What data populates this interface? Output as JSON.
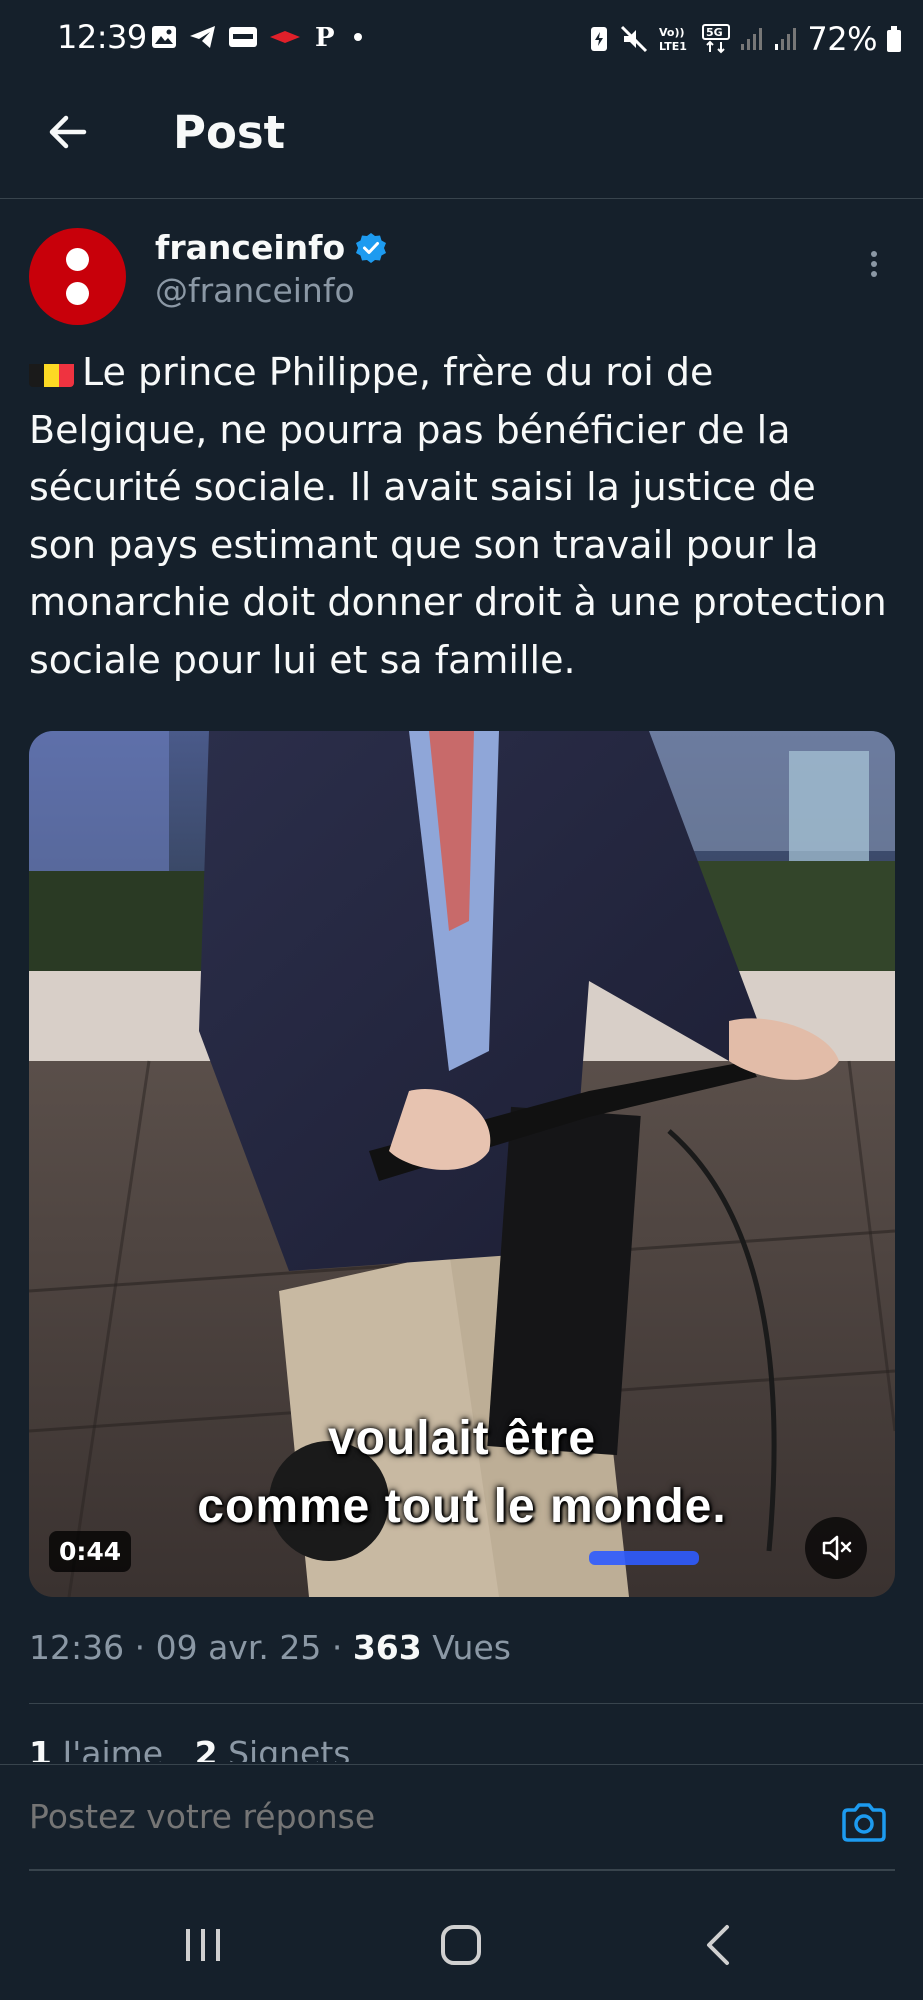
{
  "status_bar": {
    "time": "12:39",
    "battery": "72%",
    "network": "5G",
    "volte": "VoLTE1"
  },
  "header": {
    "title": "Post"
  },
  "post": {
    "author_name": "franceinfo",
    "author_handle": "@franceinfo",
    "verified": true,
    "flag": "Belgium",
    "text": "Le prince Philippe, frère du roi de Belgique, ne pourra pas bénéficier de la sécurité sociale. Il avait saisi la justice de son pays estimant que son travail pour la monarchie doit donner droit à une protection sociale pour lui et sa famille.",
    "video": {
      "subtitle_line1": "voulait être",
      "subtitle_line2": "comme tout le monde.",
      "duration": "0:44",
      "muted": true
    },
    "time": "12:36",
    "date": "09 avr. 25",
    "views_count": "363",
    "views_label": "Vues",
    "likes_count": "1",
    "likes_label": "J'aime",
    "bookmarks_count": "2",
    "bookmarks_label": "Signets"
  },
  "reply": {
    "placeholder": "Postez votre réponse"
  },
  "colors": {
    "background": "#15202b",
    "accent": "#1d9bf0",
    "muted_text": "#8b98a5",
    "avatar_red": "#c8000a"
  },
  "icons": {
    "back": "arrow-left-icon",
    "verified": "verified-badge-icon",
    "more": "more-vertical-icon",
    "mute": "volume-muted-icon",
    "camera": "camera-icon",
    "nav_recents": "recents-icon",
    "nav_home": "home-icon",
    "nav_back": "nav-back-icon"
  }
}
